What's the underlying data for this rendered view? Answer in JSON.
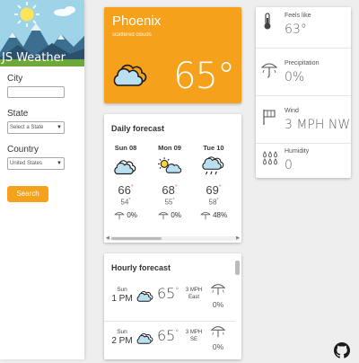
{
  "app": {
    "title": "JS Weather"
  },
  "form": {
    "city_label": "City",
    "city_value": "",
    "state_label": "State",
    "state_selected": "Select a State",
    "country_label": "Country",
    "country_selected": "United States",
    "search_label": "Search"
  },
  "current": {
    "city": "Phoenix",
    "description": "scattered clouds",
    "temp": "65°",
    "icon": "clouds-icon",
    "accent": "#f5a11c"
  },
  "details": {
    "feels_like": {
      "label": "Feels like",
      "value": "63°"
    },
    "precipitation": {
      "label": "Precipitation",
      "value": "0%"
    },
    "wind": {
      "label": "Wind",
      "value": "3 MPH NW"
    },
    "humidity": {
      "label": "Humidity",
      "value": "0"
    }
  },
  "daily": {
    "title": "Daily forecast",
    "days": [
      {
        "name": "Sun 08",
        "icon": "clouds-icon",
        "hi": "66",
        "lo": "54",
        "precip": "0%"
      },
      {
        "name": "Mon 09",
        "icon": "sun-clouds-icon",
        "hi": "68",
        "lo": "55",
        "precip": "0%"
      },
      {
        "name": "Tue 10",
        "icon": "rain-clouds-icon",
        "hi": "69",
        "lo": "58",
        "precip": "48%"
      }
    ]
  },
  "hourly": {
    "title": "Hourly forecast",
    "hours": [
      {
        "day": "Sun",
        "time": "1 PM",
        "temp": "65",
        "wind_speed": "3 MPH",
        "wind_dir": "East",
        "precip": "0%"
      },
      {
        "day": "Sun",
        "time": "2 PM",
        "temp": "65",
        "wind_speed": "3 MPH",
        "wind_dir": "SE",
        "precip": "0%"
      }
    ]
  },
  "footer": {
    "icon": "github-icon"
  }
}
